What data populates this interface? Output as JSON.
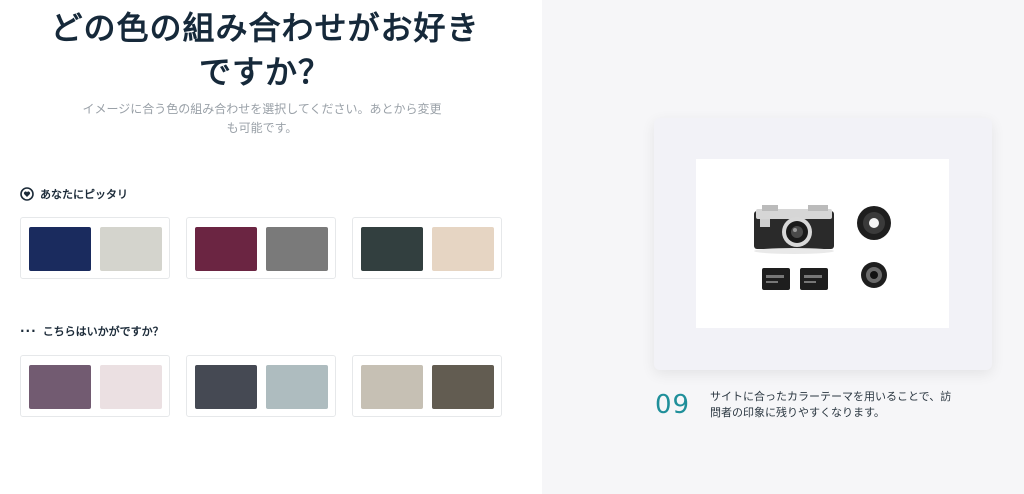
{
  "header": {
    "title_line1": "どの色の組み合わせがお好き",
    "title_line2": "ですか？",
    "subtitle_line1": "イメージに合う色の組み合わせを選択してください。あとから変更",
    "subtitle_line2": "も可能です。"
  },
  "sections": [
    {
      "label": "あなたにピッタリ",
      "icon": "heart-badge-icon",
      "palettes": [
        {
          "colors": [
            "#1a2b5e",
            "#d4d4cd"
          ]
        },
        {
          "colors": [
            "#6b2542",
            "#7a7a7a"
          ]
        },
        {
          "colors": [
            "#323f3f",
            "#e6d5c3"
          ]
        }
      ]
    },
    {
      "label": "こちらはいかがですか？",
      "prefix": "···",
      "palettes": [
        {
          "colors": [
            "#725b71",
            "#ebe0e2"
          ]
        },
        {
          "colors": [
            "#454953",
            "#aebcbf"
          ]
        },
        {
          "colors": [
            "#c6c0b4",
            "#625c51"
          ]
        }
      ]
    }
  ],
  "preview": {
    "step_number": "09",
    "caption_line1": "サイトに合ったカラーテーマを用いることで、訪",
    "caption_line2": "問者の印象に残りやすくなります。"
  },
  "colors": {
    "accent_teal": "#1f8f9a",
    "title_navy": "#16293a"
  }
}
